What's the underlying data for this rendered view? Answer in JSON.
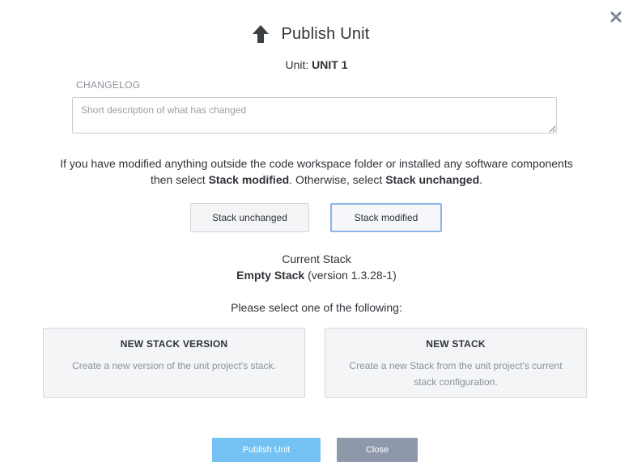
{
  "dialog": {
    "title": "Publish Unit",
    "title_icon": "arrow-up-icon",
    "close_icon": "close-icon",
    "unit_label": "Unit:",
    "unit_name": "UNIT 1"
  },
  "changelog": {
    "label": "CHANGELOG",
    "placeholder": "Short description of what has changed",
    "value": ""
  },
  "instructions": {
    "line1": "If you have modified anything outside the code workspace folder or installed any software components",
    "line2_prefix": "then select ",
    "line2_bold1": "Stack modified",
    "line2_mid": ". Otherwise, select ",
    "line2_bold2": "Stack unchanged",
    "line2_suffix": "."
  },
  "stack_toggle": {
    "unchanged_label": "Stack unchanged",
    "modified_label": "Stack modified",
    "selected": "modified"
  },
  "current_stack": {
    "label": "Current Stack",
    "name": "Empty Stack",
    "version_text": "(version 1.3.28-1)"
  },
  "options": {
    "prompt": "Please select one of the following:",
    "new_version": {
      "title": "NEW STACK VERSION",
      "description": "Create a new version of the unit project's stack."
    },
    "new_stack": {
      "title": "NEW STACK",
      "description": "Create a new Stack from the unit project's current stack configuration."
    }
  },
  "actions": {
    "publish_label": "Publish Unit",
    "close_label": "Close"
  },
  "colors": {
    "publish_button": "#74c2f4",
    "close_button": "#8e98ab",
    "selected_border": "#8ab4e3",
    "card_background": "#f4f5f7"
  }
}
